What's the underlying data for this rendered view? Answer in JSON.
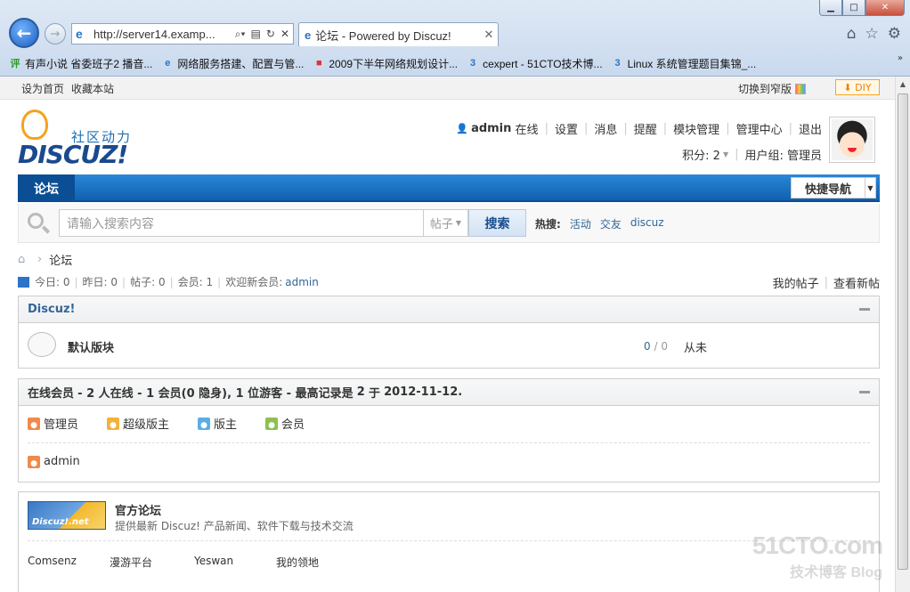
{
  "browser": {
    "url": "http://server14.examp...",
    "tab_title": "论坛 - Powered by Discuz!",
    "favorites": [
      {
        "label": "有声小说 省委班子2 播音...",
        "icon": "评",
        "color": "#2a9d2a"
      },
      {
        "label": "网络服务搭建、配置与管...",
        "icon": "e",
        "color": "#2b74c7"
      },
      {
        "label": "2009下半年网络规划设计...",
        "icon": "■",
        "color": "#d33"
      },
      {
        "label": "cexpert - 51CTO技术博...",
        "icon": "3",
        "color": "#2b74c7"
      },
      {
        "label": "Linux 系统管理题目集锦_...",
        "icon": "3",
        "color": "#2b74c7"
      }
    ]
  },
  "topbar": {
    "set_home": "设为首页",
    "bookmark": "收藏本站",
    "switch_width": "切换到窄版",
    "diy": "DIY"
  },
  "logo": {
    "slogan": "社区动力",
    "word": "DISCUZ!"
  },
  "user": {
    "name": "admin",
    "online": "在线",
    "links": [
      "设置",
      "消息",
      "提醒",
      "模块管理",
      "管理中心",
      "退出"
    ],
    "points": "积分: 2",
    "group": "用户组: 管理员"
  },
  "nav": {
    "forum": "论坛",
    "quick_nav": "快捷导航"
  },
  "search": {
    "placeholder": "请输入搜索内容",
    "type": "帖子",
    "button": "搜索",
    "hot_label": "热搜:",
    "hot_terms": [
      "活动",
      "交友",
      "discuz"
    ]
  },
  "breadcrumb": {
    "current": "论坛"
  },
  "stats": {
    "today": "今日: 0",
    "yesterday": "昨日: 0",
    "posts": "帖子: 0",
    "members": "会员: 1",
    "welcome": "欢迎新会员:",
    "newest_member": "admin",
    "my_posts": "我的帖子",
    "new_posts": "查看新帖"
  },
  "forum_section": {
    "title": "Discuz!",
    "forum_name": "默认版块",
    "count_threads": "0",
    "count_sep": " / ",
    "count_posts": "0",
    "last_post": "从未"
  },
  "online": {
    "title": "在线会员",
    "summary": "- 2 人在线 - 1 会员(0 隐身), 1 位游客 - 最高记录是",
    "record_count": "2",
    "record_sep": "于",
    "record_date": "2012-11-12.",
    "legend": [
      {
        "label": "管理员",
        "color": "#f08a4b"
      },
      {
        "label": "超级版主",
        "color": "#f4b23a"
      },
      {
        "label": "版主",
        "color": "#5aaee6"
      },
      {
        "label": "会员",
        "color": "#8cc152"
      }
    ],
    "users": [
      {
        "name": "admin",
        "color": "#f08a4b"
      }
    ]
  },
  "links": {
    "logo_text": "Discuz!.net",
    "title": "官方论坛",
    "desc": "提供最新 Discuz! 产品新闻、软件下载与技术交流",
    "items": [
      "Comsenz",
      "漫游平台",
      "Yeswan",
      "我的领地"
    ]
  },
  "watermark": {
    "line1": "51CTO.com",
    "line2": "技术博客 Blog"
  }
}
